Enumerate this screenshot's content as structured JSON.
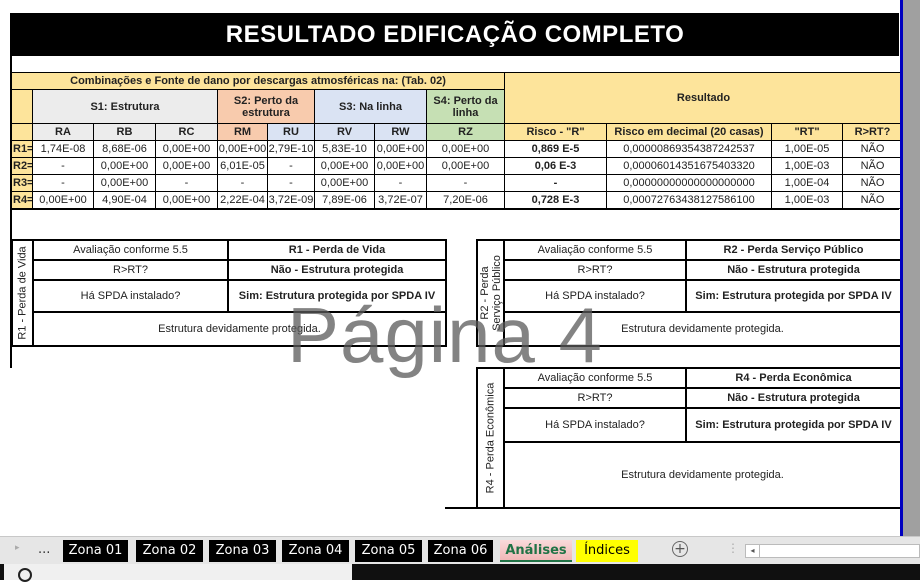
{
  "title": "RESULTADO  EDIFICAÇÃO COMPLETO",
  "main_table": {
    "combinations_header": "Combinações e Fonte de dano por descargas atmosféricas na: (Tab. 02)",
    "sources": {
      "s1": "S1: Estrutura",
      "s2": "S2: Perto da estrutura",
      "s3": "S3: Na linha",
      "s4": "S4: Perto da linha"
    },
    "result_header": "Resultado",
    "columns": [
      "RA",
      "RB",
      "RC",
      "RM",
      "RU",
      "RV",
      "RW",
      "RZ"
    ],
    "result_columns": [
      "Risco - \"R\"",
      "Risco em decimal (20 casas)",
      "\"RT\"",
      "R>RT?"
    ],
    "rows": [
      {
        "label": "R1=",
        "values": [
          "1,74E-08",
          "8,68E-06",
          "0,00E+00",
          "0,00E+00",
          "2,79E-10",
          "5,83E-10",
          "0,00E+00",
          "0,00E+00"
        ],
        "risk": "0,869 E-5",
        "decimal": "0,00000869354387242537",
        "rt": "1,00E-05",
        "gt": "NÃO"
      },
      {
        "label": "R2=",
        "values": [
          "-",
          "0,00E+00",
          "0,00E+00",
          "6,01E-05",
          "-",
          "0,00E+00",
          "0,00E+00",
          "0,00E+00"
        ],
        "risk": "0,06 E-3",
        "decimal": "0,00006014351675403320",
        "rt": "1,00E-03",
        "gt": "NÃO"
      },
      {
        "label": "R3=",
        "values": [
          "-",
          "0,00E+00",
          "-",
          "-",
          "-",
          "0,00E+00",
          "-",
          "-"
        ],
        "risk": "-",
        "decimal": "0,00000000000000000000",
        "rt": "1,00E-04",
        "gt": "NÃO"
      },
      {
        "label": "R4=",
        "values": [
          "0,00E+00",
          "4,90E-04",
          "0,00E+00",
          "2,22E-04",
          "3,72E-09",
          "7,89E-06",
          "3,72E-07",
          "7,20E-06"
        ],
        "risk": "0,728 E-3",
        "decimal": "0,00072763438127586100",
        "rt": "1,00E-03",
        "gt": "NÃO"
      }
    ]
  },
  "evaluations": [
    {
      "side_label": "R1 - Perda de Vida",
      "eval_label": "Avaliação conforme 5.5",
      "title": "R1 - Perda de Vida",
      "rrt_label": "R>RT?",
      "rrt_value": "Não - Estrutura protegida",
      "spda_label": "Há SPDA instalado?",
      "spda_value": "Sim: Estrutura protegida por SPDA IV",
      "conclusion": "Estrutura devidamente protegida."
    },
    {
      "side_label": "R2 - Perda Serviço Público",
      "eval_label": "Avaliação conforme 5.5",
      "title": "R2 - Perda Serviço Público",
      "rrt_label": "R>RT?",
      "rrt_value": "Não - Estrutura protegida",
      "spda_label": "Há SPDA instalado?",
      "spda_value": "Sim: Estrutura protegida por SPDA IV",
      "conclusion": "Estrutura devidamente protegida."
    },
    {
      "side_label": "R4 - Perda Econômica",
      "eval_label": "Avaliação conforme 5.5",
      "title": "R4 - Perda Econômica",
      "rrt_label": "R>RT?",
      "rrt_value": "Não - Estrutura protegida",
      "spda_label": "Há SPDA instalado?",
      "spda_value": "Sim: Estrutura protegida por SPDA IV",
      "conclusion": "Estrutura devidamente protegida."
    }
  ],
  "watermark": "Página 4",
  "sheet_tabs": {
    "ellipsis": "...",
    "tabs": [
      "Zona 01",
      "Zona 02",
      "Zona 03",
      "Zona 04",
      "Zona 05",
      "Zona 06",
      "Análises",
      "Índices"
    ],
    "active": "Análises",
    "colors": {
      "zona": "#000000",
      "analises": "#217346",
      "indices": "#ffff00"
    }
  }
}
